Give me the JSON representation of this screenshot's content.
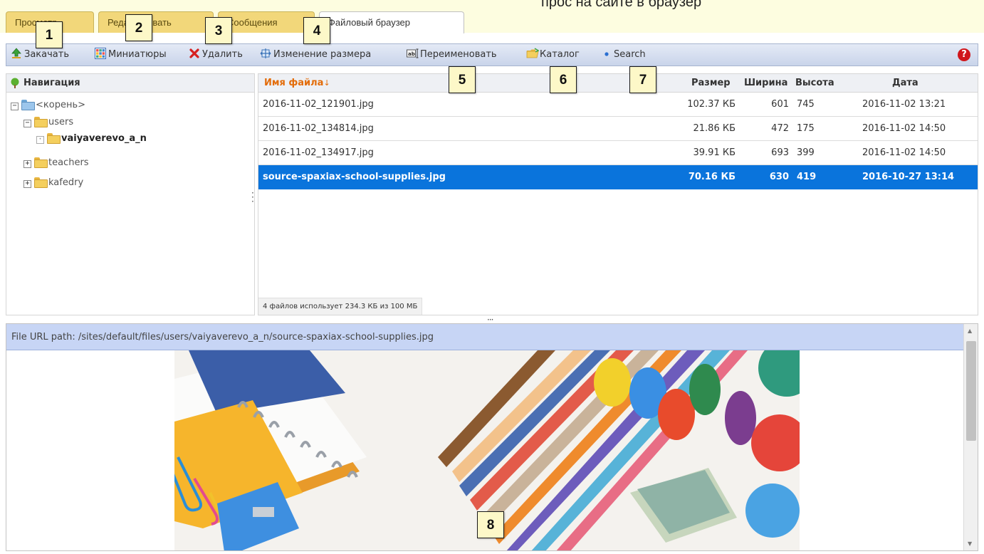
{
  "header_cut_text": "прос на сайте в браузер",
  "tabs": [
    {
      "label": "Просмотр",
      "active": false
    },
    {
      "label": "Редактировать",
      "active": false
    },
    {
      "label": "Сообщения",
      "active": false
    },
    {
      "label": "Файловый браузер",
      "active": true
    }
  ],
  "toolbar": {
    "upload": "Закачать",
    "thumbnails": "Миниатюры",
    "delete": "Удалить",
    "resize": "Изменение размера",
    "rename": "Переименовать",
    "directory": "Каталог",
    "search": "Search",
    "help": "?"
  },
  "navigation": {
    "title": "Навигация",
    "root": "<корень>",
    "items": [
      {
        "label": "users"
      },
      {
        "label": "vaiyaverevo_a_n"
      },
      {
        "label": "teachers"
      },
      {
        "label": "kafedry"
      }
    ]
  },
  "file_list": {
    "columns": {
      "name": "Имя файла",
      "size": "Размер",
      "width": "Ширина",
      "height": "Высота",
      "date": "Дата"
    },
    "rows": [
      {
        "name": "2016-11-02_121901.jpg",
        "size": "102.37 КБ",
        "width": "601",
        "height": "745",
        "date": "2016-11-02 13:21"
      },
      {
        "name": "2016-11-02_134814.jpg",
        "size": "21.86 КБ",
        "width": "472",
        "height": "175",
        "date": "2016-11-02 14:50"
      },
      {
        "name": "2016-11-02_134917.jpg",
        "size": "39.91 КБ",
        "width": "693",
        "height": "399",
        "date": "2016-11-02 14:50"
      },
      {
        "name": "source-spaxiax-school-supplies.jpg",
        "size": "70.16 КБ",
        "width": "630",
        "height": "419",
        "date": "2016-10-27 13:14"
      }
    ],
    "status": "4 файлов использует 234.3 КБ из 100 МБ"
  },
  "preview": {
    "url_label": "File URL path:",
    "url": "/sites/default/files/users/vaiyaverevo_a_n/source-spaxiax-school-supplies.jpg"
  },
  "callouts": [
    "1",
    "2",
    "3",
    "4",
    "5",
    "6",
    "7",
    "8"
  ],
  "colors": {
    "tab_bg": "#f2d77a",
    "selection": "#0a74dc",
    "sort_header": "#e36c09",
    "url_bar": "#c7d5f5",
    "help": "#d0161b"
  }
}
